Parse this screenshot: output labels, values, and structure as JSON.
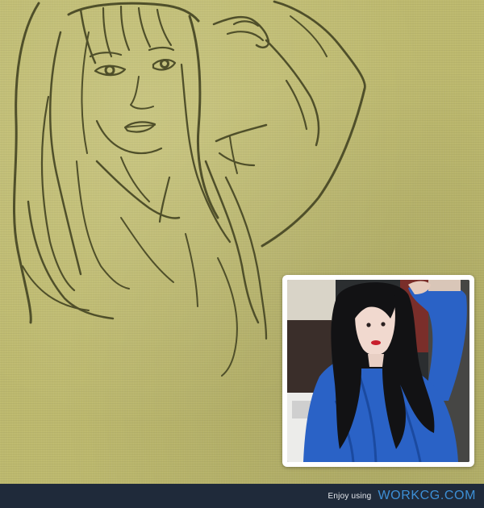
{
  "watermark": {
    "text": "Enjoy using",
    "brand": "WORKCG.COM"
  },
  "colors": {
    "background": "#bdb96e",
    "sketch_line": "#4f4f2a",
    "photo_frame": "#ffffff",
    "footer_bar": "#1f2a3a",
    "footer_brand": "#3d8fd6",
    "garment_blue": "#2a62c6"
  }
}
